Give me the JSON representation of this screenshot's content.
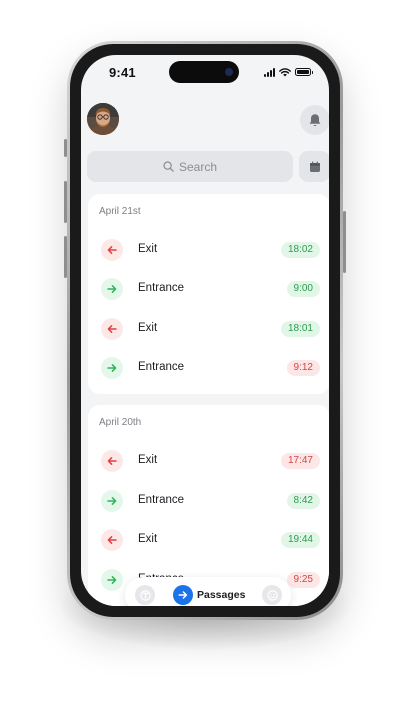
{
  "status_bar": {
    "time": "9:41"
  },
  "search": {
    "label": "Search"
  },
  "sections": [
    {
      "date": "April 21st",
      "entries": [
        {
          "type": "exit",
          "label": "Exit",
          "time": "18:02",
          "status": "green"
        },
        {
          "type": "entrance",
          "label": "Entrance",
          "time": "9:00",
          "status": "green"
        },
        {
          "type": "exit",
          "label": "Exit",
          "time": "18:01",
          "status": "green"
        },
        {
          "type": "entrance",
          "label": "Entrance",
          "time": "9:12",
          "status": "red"
        }
      ]
    },
    {
      "date": "April 20th",
      "entries": [
        {
          "type": "exit",
          "label": "Exit",
          "time": "17:47",
          "status": "red"
        },
        {
          "type": "entrance",
          "label": "Entrance",
          "time": "8:42",
          "status": "green"
        },
        {
          "type": "exit",
          "label": "Exit",
          "time": "19:44",
          "status": "green"
        },
        {
          "type": "entrance",
          "label": "Entrance",
          "time": "9:25",
          "status": "red"
        }
      ]
    }
  ],
  "tabbar": {
    "left_icon": "wallet-icon",
    "active_icon": "arrow-right-icon",
    "active_label": "Passages",
    "right_icon": "smiley-icon"
  },
  "colors": {
    "exit_red": "#e53e3e",
    "entrance_green": "#2fb457",
    "accent_blue": "#1a73e8",
    "background": "#f3f4f6"
  }
}
